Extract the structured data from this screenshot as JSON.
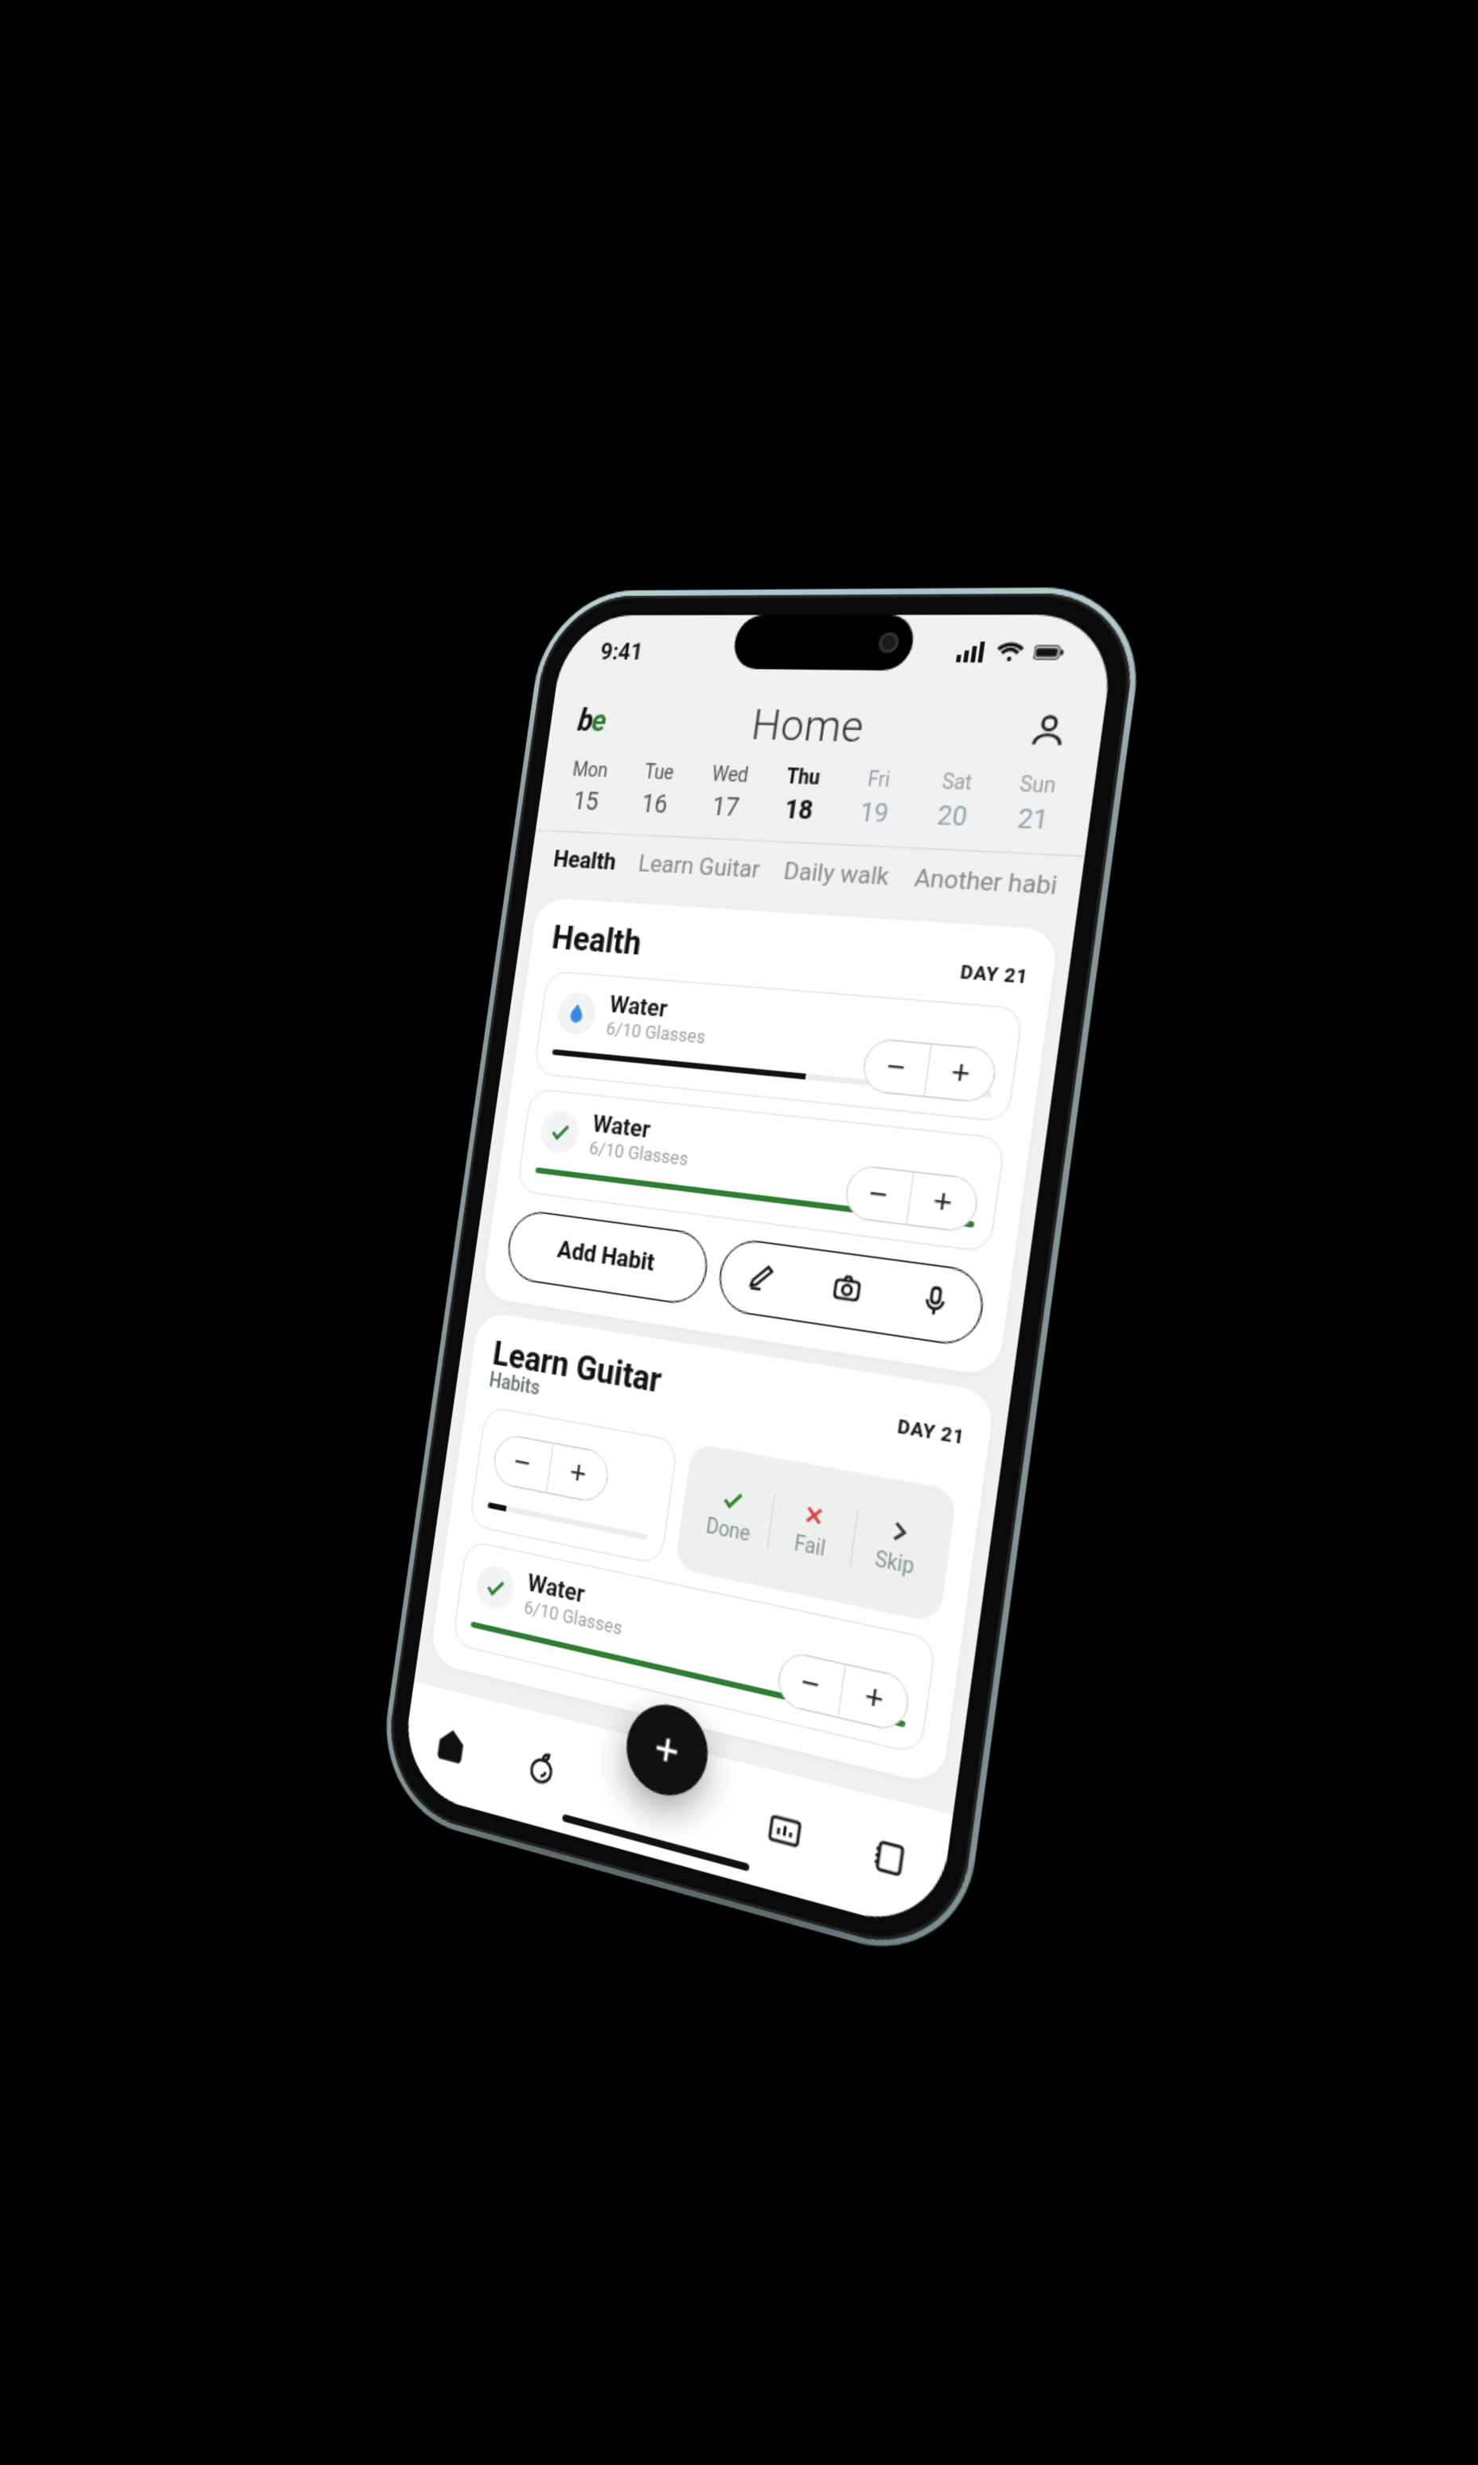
{
  "status_bar": {
    "time": "9:41"
  },
  "header": {
    "logo_text_1": "b",
    "logo_text_2": "e",
    "title": "Home"
  },
  "dates": [
    {
      "dow": "Mon",
      "num": "15",
      "state": "past"
    },
    {
      "dow": "Tue",
      "num": "16",
      "state": "past"
    },
    {
      "dow": "Wed",
      "num": "17",
      "state": "past"
    },
    {
      "dow": "Thu",
      "num": "18",
      "state": "active"
    },
    {
      "dow": "Fri",
      "num": "19",
      "state": "future"
    },
    {
      "dow": "Sat",
      "num": "20",
      "state": "future"
    },
    {
      "dow": "Sun",
      "num": "21",
      "state": "future"
    }
  ],
  "tabs": [
    {
      "label": "Health",
      "active": true
    },
    {
      "label": "Learn Guitar",
      "active": false
    },
    {
      "label": "Daily walk",
      "active": false
    },
    {
      "label": "Another habi",
      "active": false
    }
  ],
  "sections": {
    "health": {
      "title": "Health",
      "day_badge": "DAY 21",
      "habits": [
        {
          "icon": "water",
          "name": "Water",
          "sub": "6/10 Glasses",
          "progress_pct": 60,
          "bar_color": "black"
        },
        {
          "icon": "done",
          "name": "Water",
          "sub": "6/10 Glasses",
          "progress_pct": 100,
          "bar_color": "green"
        }
      ],
      "add_label": "Add Habit"
    },
    "guitar": {
      "title": "Learn Guitar",
      "subtitle": "Habits",
      "day_badge": "DAY 21",
      "swipe": {
        "done": "Done",
        "fail": "Fail",
        "skip": "Skip"
      },
      "habit": {
        "icon": "done",
        "name": "Water",
        "sub": "6/10 Glasses",
        "progress_pct": 100,
        "bar_color": "green"
      }
    }
  },
  "stepper": {
    "minus": "−",
    "plus": "+"
  },
  "colors": {
    "green": "#2e7d32",
    "blue": "#3b8ae0",
    "red": "#d64545"
  }
}
